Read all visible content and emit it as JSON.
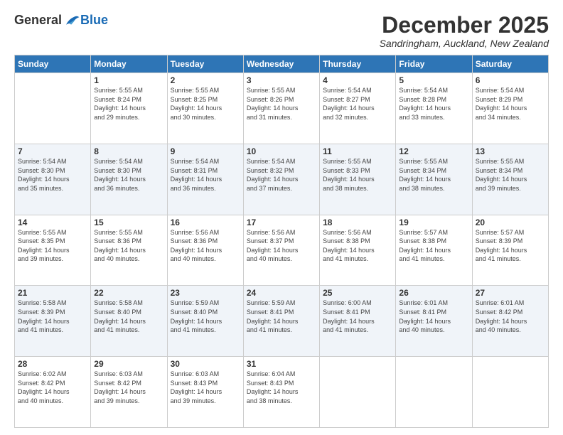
{
  "logo": {
    "general": "General",
    "blue": "Blue"
  },
  "title": "December 2025",
  "location": "Sandringham, Auckland, New Zealand",
  "days_of_week": [
    "Sunday",
    "Monday",
    "Tuesday",
    "Wednesday",
    "Thursday",
    "Friday",
    "Saturday"
  ],
  "weeks": [
    [
      {
        "day": "",
        "info": ""
      },
      {
        "day": "1",
        "info": "Sunrise: 5:55 AM\nSunset: 8:24 PM\nDaylight: 14 hours\nand 29 minutes."
      },
      {
        "day": "2",
        "info": "Sunrise: 5:55 AM\nSunset: 8:25 PM\nDaylight: 14 hours\nand 30 minutes."
      },
      {
        "day": "3",
        "info": "Sunrise: 5:55 AM\nSunset: 8:26 PM\nDaylight: 14 hours\nand 31 minutes."
      },
      {
        "day": "4",
        "info": "Sunrise: 5:54 AM\nSunset: 8:27 PM\nDaylight: 14 hours\nand 32 minutes."
      },
      {
        "day": "5",
        "info": "Sunrise: 5:54 AM\nSunset: 8:28 PM\nDaylight: 14 hours\nand 33 minutes."
      },
      {
        "day": "6",
        "info": "Sunrise: 5:54 AM\nSunset: 8:29 PM\nDaylight: 14 hours\nand 34 minutes."
      }
    ],
    [
      {
        "day": "7",
        "info": "Sunrise: 5:54 AM\nSunset: 8:30 PM\nDaylight: 14 hours\nand 35 minutes."
      },
      {
        "day": "8",
        "info": "Sunrise: 5:54 AM\nSunset: 8:30 PM\nDaylight: 14 hours\nand 36 minutes."
      },
      {
        "day": "9",
        "info": "Sunrise: 5:54 AM\nSunset: 8:31 PM\nDaylight: 14 hours\nand 36 minutes."
      },
      {
        "day": "10",
        "info": "Sunrise: 5:54 AM\nSunset: 8:32 PM\nDaylight: 14 hours\nand 37 minutes."
      },
      {
        "day": "11",
        "info": "Sunrise: 5:55 AM\nSunset: 8:33 PM\nDaylight: 14 hours\nand 38 minutes."
      },
      {
        "day": "12",
        "info": "Sunrise: 5:55 AM\nSunset: 8:34 PM\nDaylight: 14 hours\nand 38 minutes."
      },
      {
        "day": "13",
        "info": "Sunrise: 5:55 AM\nSunset: 8:34 PM\nDaylight: 14 hours\nand 39 minutes."
      }
    ],
    [
      {
        "day": "14",
        "info": "Sunrise: 5:55 AM\nSunset: 8:35 PM\nDaylight: 14 hours\nand 39 minutes."
      },
      {
        "day": "15",
        "info": "Sunrise: 5:55 AM\nSunset: 8:36 PM\nDaylight: 14 hours\nand 40 minutes."
      },
      {
        "day": "16",
        "info": "Sunrise: 5:56 AM\nSunset: 8:36 PM\nDaylight: 14 hours\nand 40 minutes."
      },
      {
        "day": "17",
        "info": "Sunrise: 5:56 AM\nSunset: 8:37 PM\nDaylight: 14 hours\nand 40 minutes."
      },
      {
        "day": "18",
        "info": "Sunrise: 5:56 AM\nSunset: 8:38 PM\nDaylight: 14 hours\nand 41 minutes."
      },
      {
        "day": "19",
        "info": "Sunrise: 5:57 AM\nSunset: 8:38 PM\nDaylight: 14 hours\nand 41 minutes."
      },
      {
        "day": "20",
        "info": "Sunrise: 5:57 AM\nSunset: 8:39 PM\nDaylight: 14 hours\nand 41 minutes."
      }
    ],
    [
      {
        "day": "21",
        "info": "Sunrise: 5:58 AM\nSunset: 8:39 PM\nDaylight: 14 hours\nand 41 minutes."
      },
      {
        "day": "22",
        "info": "Sunrise: 5:58 AM\nSunset: 8:40 PM\nDaylight: 14 hours\nand 41 minutes."
      },
      {
        "day": "23",
        "info": "Sunrise: 5:59 AM\nSunset: 8:40 PM\nDaylight: 14 hours\nand 41 minutes."
      },
      {
        "day": "24",
        "info": "Sunrise: 5:59 AM\nSunset: 8:41 PM\nDaylight: 14 hours\nand 41 minutes."
      },
      {
        "day": "25",
        "info": "Sunrise: 6:00 AM\nSunset: 8:41 PM\nDaylight: 14 hours\nand 41 minutes."
      },
      {
        "day": "26",
        "info": "Sunrise: 6:01 AM\nSunset: 8:41 PM\nDaylight: 14 hours\nand 40 minutes."
      },
      {
        "day": "27",
        "info": "Sunrise: 6:01 AM\nSunset: 8:42 PM\nDaylight: 14 hours\nand 40 minutes."
      }
    ],
    [
      {
        "day": "28",
        "info": "Sunrise: 6:02 AM\nSunset: 8:42 PM\nDaylight: 14 hours\nand 40 minutes."
      },
      {
        "day": "29",
        "info": "Sunrise: 6:03 AM\nSunset: 8:42 PM\nDaylight: 14 hours\nand 39 minutes."
      },
      {
        "day": "30",
        "info": "Sunrise: 6:03 AM\nSunset: 8:43 PM\nDaylight: 14 hours\nand 39 minutes."
      },
      {
        "day": "31",
        "info": "Sunrise: 6:04 AM\nSunset: 8:43 PM\nDaylight: 14 hours\nand 38 minutes."
      },
      {
        "day": "",
        "info": ""
      },
      {
        "day": "",
        "info": ""
      },
      {
        "day": "",
        "info": ""
      }
    ]
  ]
}
